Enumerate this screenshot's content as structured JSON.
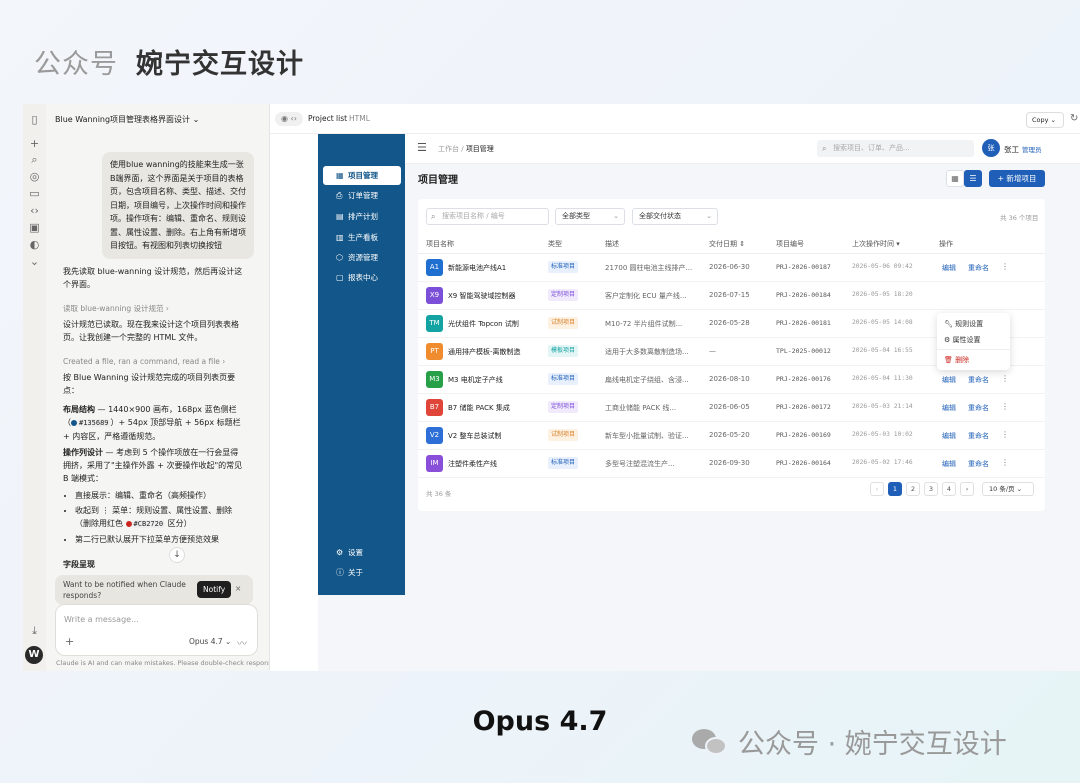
{
  "watermark_top": {
    "light": "公众号",
    "bold": "婉宁交互设计"
  },
  "bottom": {
    "model": "Opus 4.7",
    "watermark": "公众号 · 婉宁交互设计"
  },
  "rail": {
    "avatar": "W"
  },
  "chat": {
    "title": "Blue Wanning项目管理表格界面设计 ⌄",
    "user_message": "使用blue wanning的技能来生成一张B端界面，这个界面是关于项目的表格页，包含项目名称、类型、描述、交付日期，项目编号，上次操作时间和操作项。操作项有：编辑、重命名、规则设置、属性设置、删除。右上角有新增项目按钮。有视图和列表切换按钮",
    "reply_1": "我先读取 blue-wanning 设计规范，然后再设计这个界面。",
    "step_1": "读取 blue-wanning 设计规范 ›",
    "reply_2": "设计规范已读取。现在我来设计这个项目列表表格页。让我创建一个完整的 HTML 文件。",
    "step_2": "Created a file, ran a command, read a file ›",
    "reply_3": "按 Blue Wanning 设计规范完成的项目列表页要点：",
    "layout_bold": "布局结构",
    "layout_a": " — 1440×900 画布，168px 蓝色侧栏（",
    "layout_code": "#135689",
    "layout_b": "）+ 54px 顶部导航 + 56px 标题栏 + 内容区，严格遵循规范。",
    "ops_bold": "操作列设计",
    "ops_text": " — 考虑到 5 个操作项放在一行会显得拥挤，采用了\"主操作外露 + 次要操作收起\"的常见 B 端模式：",
    "bullet_1": "直接展示：编辑、重命名（高频操作）",
    "bullet_2a": "收起到 ⋮ 菜单：规则设置、属性设置、删除（删除用红色 ",
    "bullet_2_code": "#CB2720",
    "bullet_2b": " 区分）",
    "bullet_3": "第二行已默认展开下拉菜单方便预览效果",
    "fields_heading": "字段呈现",
    "notify_text": "Want to be notified when Claude responds?",
    "notify_btn": "Notify",
    "input_placeholder": "Write a message...",
    "model": "Opus 4.7 ⌄",
    "disclaimer": "Claude is AI and can make mistakes. Please double-check responses."
  },
  "preview_bar": {
    "name": "Project list",
    "type": "HTML",
    "copy": "Copy  ⌄"
  },
  "app": {
    "nav": [
      {
        "icon": "▦",
        "label": "项目管理"
      },
      {
        "icon": "⎙",
        "label": "订单管理"
      },
      {
        "icon": "▤",
        "label": "排产计划"
      },
      {
        "icon": "▥",
        "label": "生产看板"
      },
      {
        "icon": "⬡",
        "label": "资源管理"
      },
      {
        "icon": "▢",
        "label": "报表中心"
      }
    ],
    "nav_bottom": [
      {
        "icon": "⚙",
        "label": "设置"
      },
      {
        "icon": "ⓘ",
        "label": "关于"
      }
    ],
    "breadcrumb": {
      "root": "工作台  /  ",
      "current": "项目管理"
    },
    "search_placeholder": "搜索项目、订单、产品...",
    "user": {
      "avatar": "张",
      "name": "张工",
      "role": "管理员"
    },
    "page_title": "项目管理",
    "new_button": "+ 新增项目",
    "filters": {
      "search": "搜索项目名称 / 编号",
      "type": "全部类型",
      "status": "全部交付状态",
      "total": "共 36 个项目"
    },
    "headers": [
      "项目名称",
      "类型",
      "描述",
      "交付日期 ⇕",
      "项目编号",
      "上次操作时间 ▾",
      "操作"
    ],
    "actions": {
      "edit": "编辑",
      "rename": "重命名"
    },
    "rows": [
      {
        "code": "A1",
        "color": "#1f6fd1",
        "name": "新能源电池产线A1",
        "type": "标准项目",
        "tag": "std",
        "desc": "21700 圆柱电池主线排产...",
        "date": "2026-06-30",
        "id": "PRJ-2026-00187",
        "time": "2026-05-06 09:42"
      },
      {
        "code": "X9",
        "color": "#7b4fd8",
        "name": "X9 智能驾驶域控制器",
        "type": "定制项目",
        "tag": "custom",
        "desc": "客户定制化 ECU 量产线...",
        "date": "2026-07-15",
        "id": "PRJ-2026-00184",
        "time": "2026-05-05 18:20"
      },
      {
        "code": "TM",
        "color": "#14a3a3",
        "name": "光伏组件 Topcon 试制",
        "type": "试制项目",
        "tag": "trial",
        "desc": "M10-72 半片组件试制...",
        "date": "2026-05-28",
        "id": "PRJ-2026-00181",
        "time": "2026-05-05 14:08"
      },
      {
        "code": "PT",
        "color": "#f08c2d",
        "name": "通用排产模板-离散制造",
        "type": "模板项目",
        "tag": "tpl",
        "desc": "适用于大多数离散制造场...",
        "date": "—",
        "id": "TPL-2025-00012",
        "time": "2026-05-04 16:55"
      },
      {
        "code": "M3",
        "color": "#27a047",
        "name": "M3 电机定子产线",
        "type": "标准项目",
        "tag": "std",
        "desc": "扁线电机定子绕组、含浸...",
        "date": "2026-08-10",
        "id": "PRJ-2026-00176",
        "time": "2026-05-04 11:30"
      },
      {
        "code": "B7",
        "color": "#e0453a",
        "name": "B7 储能 PACK 集成",
        "type": "定制项目",
        "tag": "custom",
        "desc": "工商业储能 PACK 线...",
        "date": "2026-06-05",
        "id": "PRJ-2026-00172",
        "time": "2026-05-03 21:14"
      },
      {
        "code": "V2",
        "color": "#2d6fd6",
        "name": "V2 整车总装试制",
        "type": "试制项目",
        "tag": "trial",
        "desc": "新车型小批量试制、验证...",
        "date": "2026-05-20",
        "id": "PRJ-2026-00169",
        "time": "2026-05-03 10:02"
      },
      {
        "code": "IM",
        "color": "#8a4fd8",
        "name": "注塑件柔性产线",
        "type": "标准项目",
        "tag": "std",
        "desc": "多型号注塑混流生产...",
        "date": "2026-09-30",
        "id": "PRJ-2026-00164",
        "time": "2026-05-02 17:46"
      }
    ],
    "menu": {
      "rule": "规则设置",
      "attr": "属性设置",
      "del": "删除"
    },
    "footer": "共 36 条",
    "pages": [
      "‹",
      "1",
      "2",
      "3",
      "4",
      "›"
    ],
    "page_size": "10 条/页  ⌄",
    "tag_colors": {
      "std": {
        "bg": "#e8f0fd",
        "fg": "#1f5fb8"
      },
      "custom": {
        "bg": "#f1eafd",
        "fg": "#7b4fd8"
      },
      "trial": {
        "bg": "#fdf1e2",
        "fg": "#d9822b"
      },
      "tpl": {
        "bg": "#e3f6f5",
        "fg": "#14a3a3"
      }
    }
  }
}
